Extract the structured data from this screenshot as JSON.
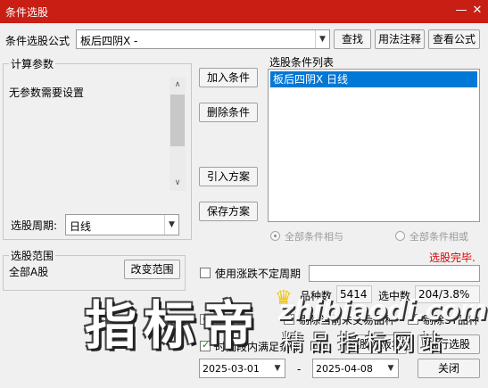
{
  "window": {
    "title": "条件选股",
    "minimize_icon": "minus",
    "close_icon": "x"
  },
  "formula_row": {
    "label": "条件选股公式",
    "value": "板后四阴X  -",
    "find_button": "查找",
    "usage_button": "用法注释",
    "view_button": "查看公式"
  },
  "params": {
    "legend": "计算参数",
    "text": "无参数需要设置",
    "period_label": "选股周期:",
    "period_value": "日线"
  },
  "middle_buttons": {
    "add": "加入条件",
    "delete": "删除条件",
    "import": "引入方案",
    "save": "保存方案"
  },
  "conditions": {
    "label": "选股条件列表",
    "items": [
      "板后四阴X  日线"
    ],
    "radio_and": "全部条件相与",
    "radio_or": "全部条件相或",
    "status": "选股完毕.",
    "status_color": "#e00000"
  },
  "scope": {
    "legend": "选股范围",
    "text": "全部A股",
    "change_button": "改变范围"
  },
  "options": {
    "indefinite_period": "使用涨跌不定周期",
    "stock_count_label": "品种数",
    "stock_count_value": "5414",
    "selected_label": "选中数",
    "selected_value": "204/3.8%",
    "pre_adjust": "前复权",
    "exclude_current": "剔除当前未交易品种",
    "exclude_st": "剔除ST品种",
    "time_range_label": "时间段内满足条件",
    "date_from": "2025-03-01",
    "date_sep": "-",
    "date_to": "2025-04-08",
    "select_to_block": "选股入板块",
    "execute": "执行选股",
    "close": "关闭"
  },
  "watermark": {
    "big_text": "指标帝",
    "url_text": "zhibiaodi.com",
    "slogan": "精品指标网站"
  }
}
